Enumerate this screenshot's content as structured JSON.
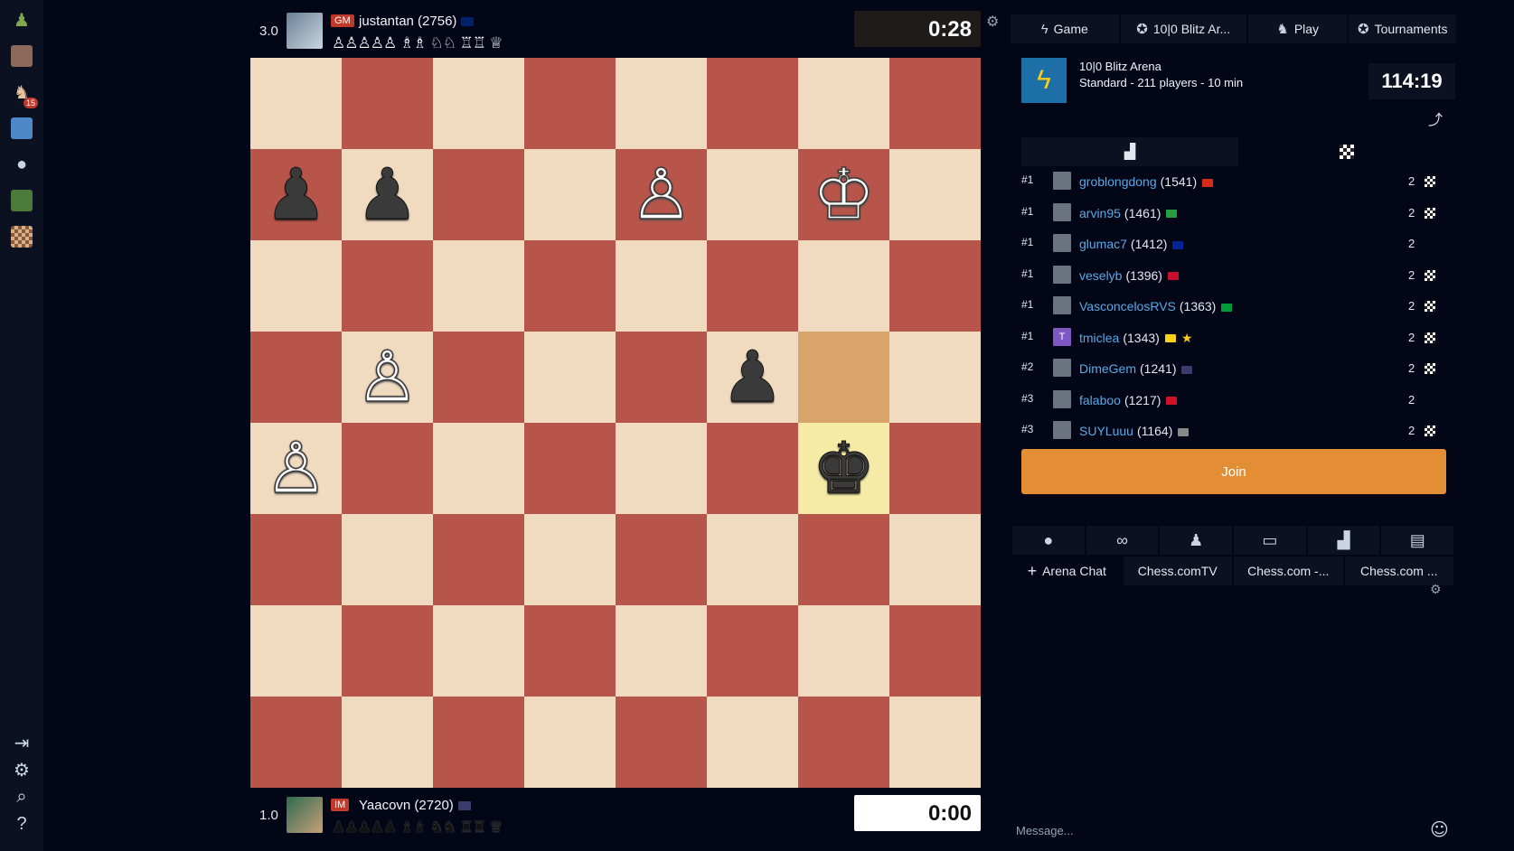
{
  "top_player": {
    "score": "3.0",
    "title": "GM",
    "name": "justantan (2756)",
    "captured": "♙♙♙♙♙ ♗♗ ♘♘ ♖♖ ♕",
    "clock": "0:28"
  },
  "bottom_player": {
    "score": "1.0",
    "title": "IM",
    "name": "Yaacovn (2720)",
    "captured": "♟♟♟♟♟ ♝♝ ♞♞ ♜♜ ♛",
    "clock": "0:00"
  },
  "board": {
    "position": [
      [
        "",
        "",
        "",
        "",
        "",
        "",
        "",
        ""
      ],
      [
        "bp",
        "bp",
        "",
        "",
        "wp",
        "",
        "wk",
        ""
      ],
      [
        "",
        "",
        "",
        "",
        "",
        "",
        "",
        ""
      ],
      [
        "",
        "wp",
        "",
        "",
        "",
        "bp",
        "",
        ""
      ],
      [
        "wp",
        "",
        "",
        "",
        "",
        "",
        "bk",
        ""
      ],
      [
        "",
        "",
        "",
        "",
        "",
        "",
        "",
        ""
      ],
      [
        "",
        "",
        "",
        "",
        "",
        "",
        "",
        ""
      ],
      [
        "",
        "",
        "",
        "",
        "",
        "",
        "",
        ""
      ]
    ],
    "last_move_from": [
      3,
      6
    ],
    "last_move_to": [
      4,
      6
    ],
    "light_color": "#f0dac0",
    "dark_color": "#b8554b"
  },
  "tabs": [
    {
      "icon": "lightning-icon",
      "glyph": "ϟ",
      "label": "Game"
    },
    {
      "icon": "medal-icon",
      "glyph": "✪",
      "label": "10|0 Blitz Ar..."
    },
    {
      "icon": "play-icon",
      "glyph": "♞",
      "label": "Play"
    },
    {
      "icon": "trophy-icon",
      "glyph": "✪",
      "label": "Tournaments"
    }
  ],
  "event": {
    "title": "10|0 Blitz Arena",
    "subtitle": "Standard - 211 players - 10 min",
    "timer": "114:19"
  },
  "standings": [
    {
      "rank": "#1",
      "name": "groblongdong",
      "rating": "(1541)",
      "flag": "#d52b1e",
      "score": "2",
      "checker": true,
      "avatar": ""
    },
    {
      "rank": "#1",
      "name": "arvin95",
      "rating": "(1461)",
      "flag": "#239f40",
      "score": "2",
      "checker": true,
      "avatar": ""
    },
    {
      "rank": "#1",
      "name": "glumac7",
      "rating": "(1412)",
      "flag": "#002395",
      "score": "2",
      "checker": false,
      "avatar": ""
    },
    {
      "rank": "#1",
      "name": "veselyb",
      "rating": "(1396)",
      "flag": "#c8102e",
      "score": "2",
      "checker": true,
      "avatar": ""
    },
    {
      "rank": "#1",
      "name": "VasconcelosRVS",
      "rating": "(1363)",
      "flag": "#009c3b",
      "score": "2",
      "checker": true,
      "avatar": ""
    },
    {
      "rank": "#1",
      "name": "tmiclea",
      "rating": "(1343)",
      "flag": "#fcd116",
      "score": "2",
      "checker": true,
      "avatar": "T",
      "star": "★"
    },
    {
      "rank": "#2",
      "name": "DimeGem",
      "rating": "(1241)",
      "flag": "#3c3b6e",
      "score": "2",
      "checker": true,
      "avatar": ""
    },
    {
      "rank": "#3",
      "name": "falaboo",
      "rating": "(1217)",
      "flag": "#ce1126",
      "score": "2",
      "checker": false,
      "avatar": ""
    },
    {
      "rank": "#3",
      "name": "SUYLuuu",
      "rating": "(1164)",
      "flag": "#888888",
      "score": "2",
      "checker": true,
      "avatar": ""
    }
  ],
  "join_label": "Join",
  "rooms": [
    {
      "label": "Arena Chat",
      "prefix": "+"
    },
    {
      "label": "Chess.comTV",
      "prefix": ""
    },
    {
      "label": "Chess.com -...",
      "prefix": ""
    },
    {
      "label": "Chess.com ...",
      "prefix": ""
    }
  ],
  "message_placeholder": "Message...",
  "colors": {
    "accent": "#e38d35",
    "link": "#5aa9e6",
    "background": "#020617"
  }
}
